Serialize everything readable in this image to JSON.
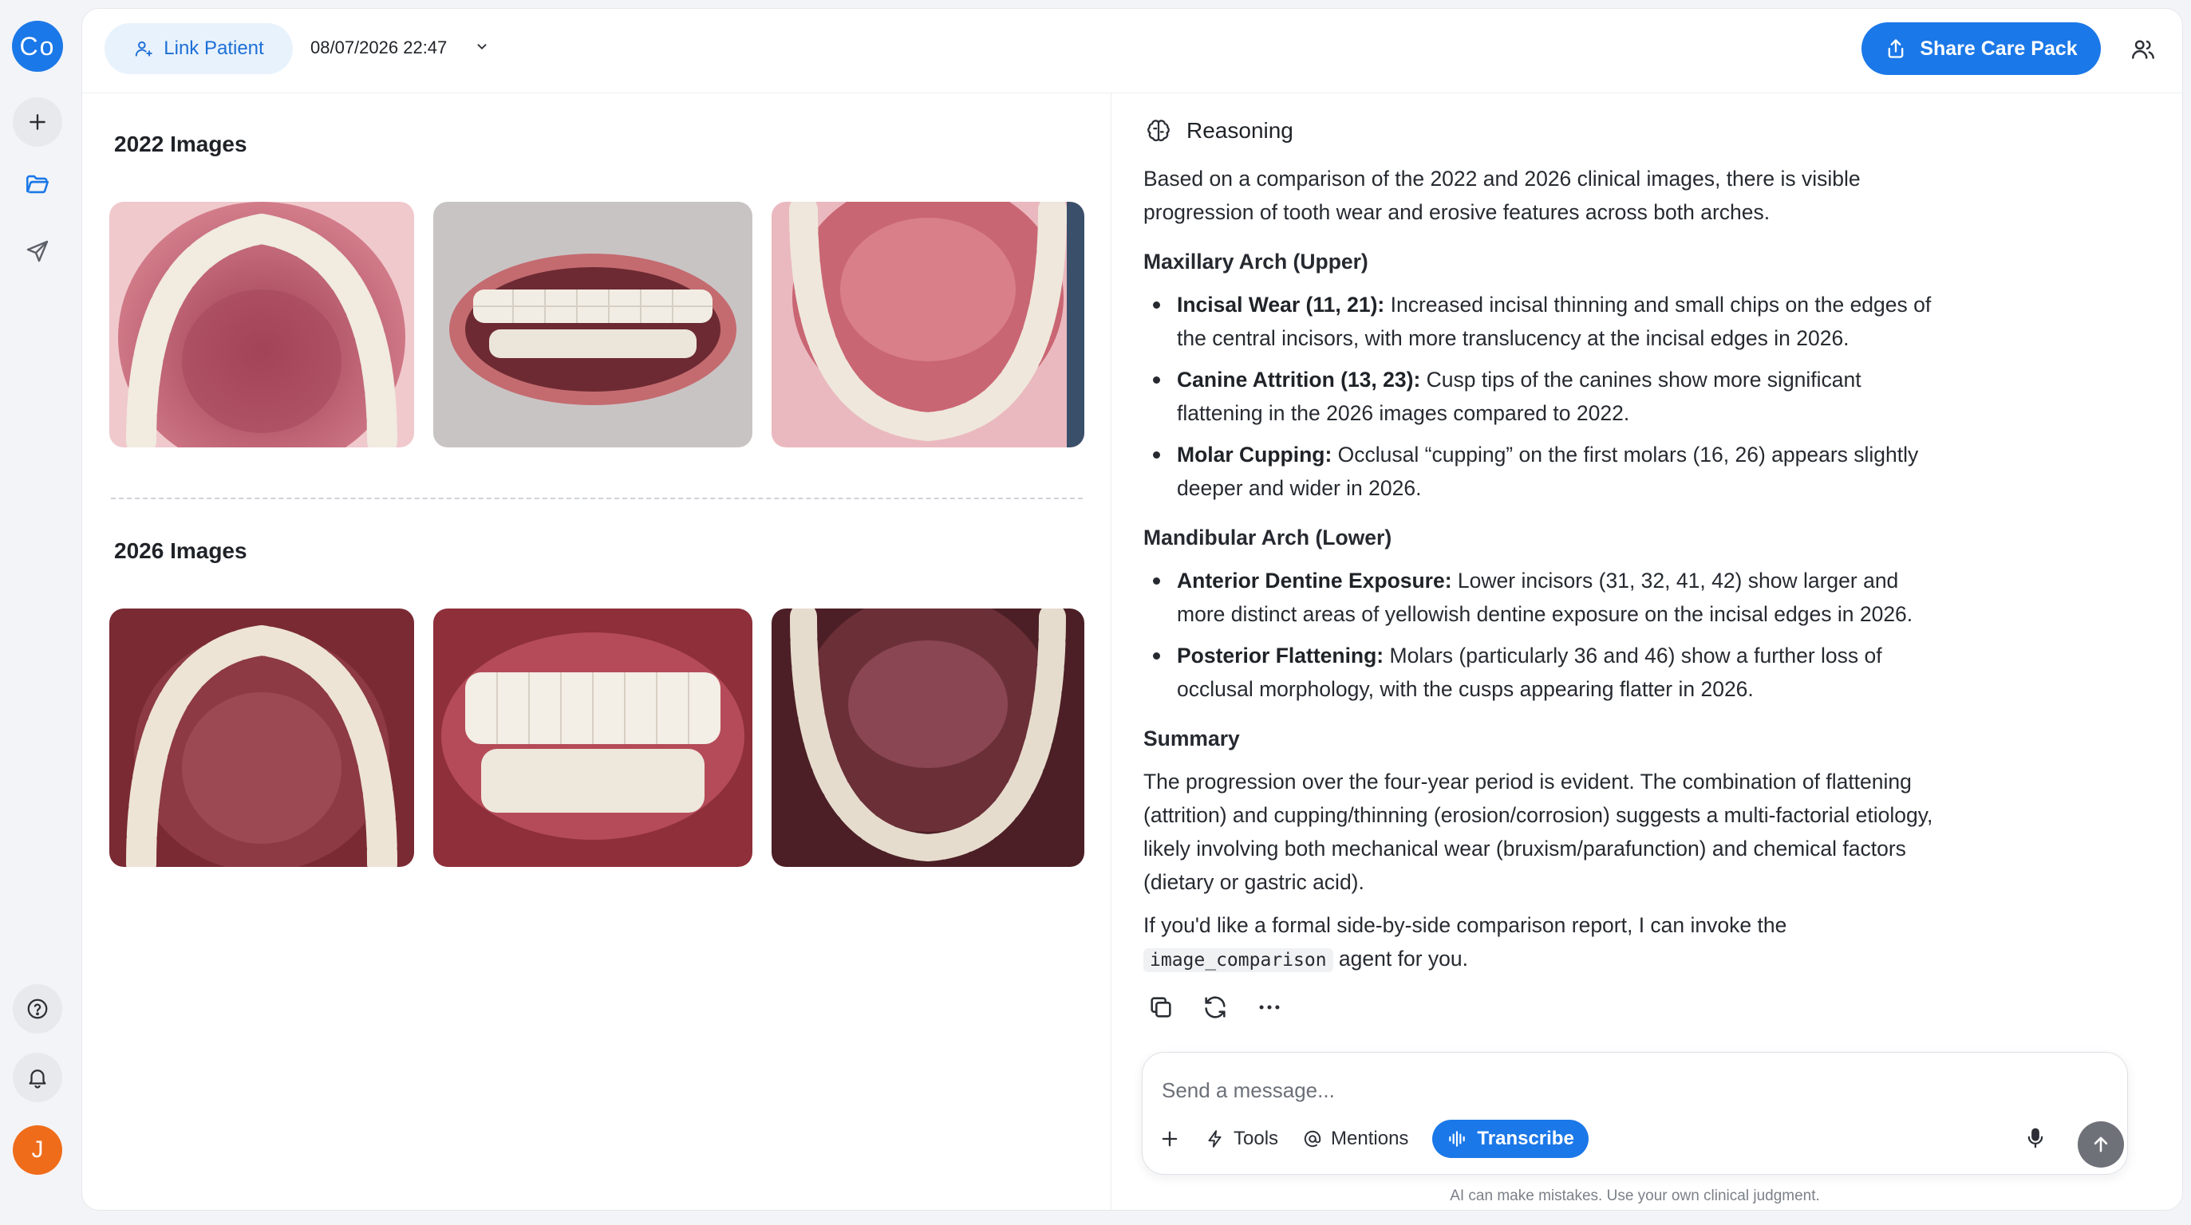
{
  "rail": {
    "logo_text": "Co",
    "avatar_initial": "J"
  },
  "topbar": {
    "link_patient_label": "Link Patient",
    "date": "08/07/2026 22:47",
    "share_label": "Share Care Pack"
  },
  "images": {
    "section_2022": "2022 Images",
    "section_2026": "2026 Images"
  },
  "reasoning": {
    "title": "Reasoning",
    "intro": "Based on a comparison of the 2022 and 2026 clinical images, there is visible progression of tooth wear and erosive features across both arches.",
    "maxillary_heading": "Maxillary Arch (Upper)",
    "maxillary_items": [
      {
        "label": "Incisal Wear (11, 21):",
        "text": " Increased incisal thinning and small chips on the edges of the central incisors, with more translucency at the incisal edges in 2026."
      },
      {
        "label": "Canine Attrition (13, 23):",
        "text": " Cusp tips of the canines show more significant flattening in the 2026 images compared to 2022."
      },
      {
        "label": "Molar Cupping:",
        "text": " Occlusal “cupping” on the first molars (16, 26) appears slightly deeper and wider in 2026."
      }
    ],
    "mandibular_heading": "Mandibular Arch (Lower)",
    "mandibular_items": [
      {
        "label": "Anterior Dentine Exposure:",
        "text": " Lower incisors (31, 32, 41, 42) show larger and more distinct areas of yellowish dentine exposure on the incisal edges in 2026."
      },
      {
        "label": "Posterior Flattening:",
        "text": " Molars (particularly 36 and 46) show a further loss of occlusal morphology, with the cusps appearing flatter in 2026."
      }
    ],
    "summary_heading": "Summary",
    "summary_text": "The progression over the four-year period is evident. The combination of flattening (attrition) and cupping/thinning (erosion/corrosion) suggests a multi-factorial etiology, likely involving both mechanical wear (bruxism/parafunction) and chemical factors (dietary or gastric acid).",
    "closing_before": "If you'd like a formal side-by-side comparison report, I can invoke the ",
    "closing_code": "image_comparison",
    "closing_after": " agent for you."
  },
  "composer": {
    "placeholder": "Send a message...",
    "tools_label": "Tools",
    "mentions_label": "Mentions",
    "transcribe_label": "Transcribe"
  },
  "disclaimer": "AI can make mistakes. Use your own clinical judgment.",
  "colors": {
    "accent": "#1b78e8",
    "avatar": "#ef6c1a",
    "gum": "#b8505e",
    "tooth": "#f3ece2"
  }
}
